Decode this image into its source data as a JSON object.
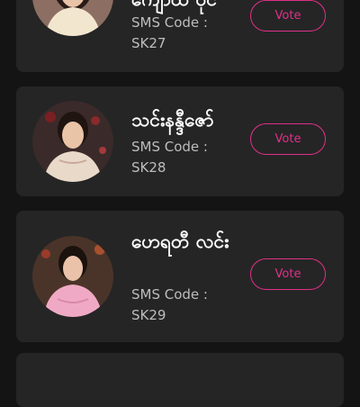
{
  "candidates": [
    {
      "name": "ကျော်ထဲ ဝိုင်",
      "sms_label": "SMS Code :",
      "sms_code": "SK27",
      "vote_label": "Vote"
    },
    {
      "name": "သင်းနန္ဒီဇော်",
      "sms_label": "SMS Code :",
      "sms_code": "SK28",
      "vote_label": "Vote"
    },
    {
      "name": "ဟေရတီ လင်း",
      "sms_label": "SMS Code :",
      "sms_code": "SK29",
      "vote_label": "Vote"
    }
  ],
  "colors": {
    "accent": "#e0308a",
    "card": "#252525",
    "background": "#141414"
  }
}
